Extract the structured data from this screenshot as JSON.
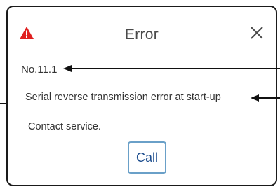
{
  "dialog": {
    "title": "Error",
    "code": "No.11.1",
    "message": "Serial reverse transmission error at start-up",
    "contact": "Contact service.",
    "call_label": "Call"
  },
  "icons": {
    "warning": "warning-triangle-icon",
    "close": "close-icon"
  },
  "colors": {
    "warning_red": "#e02020",
    "call_border": "#6aa0c8",
    "call_text": "#1f4f8f",
    "dialog_border": "#1a1a1a"
  }
}
